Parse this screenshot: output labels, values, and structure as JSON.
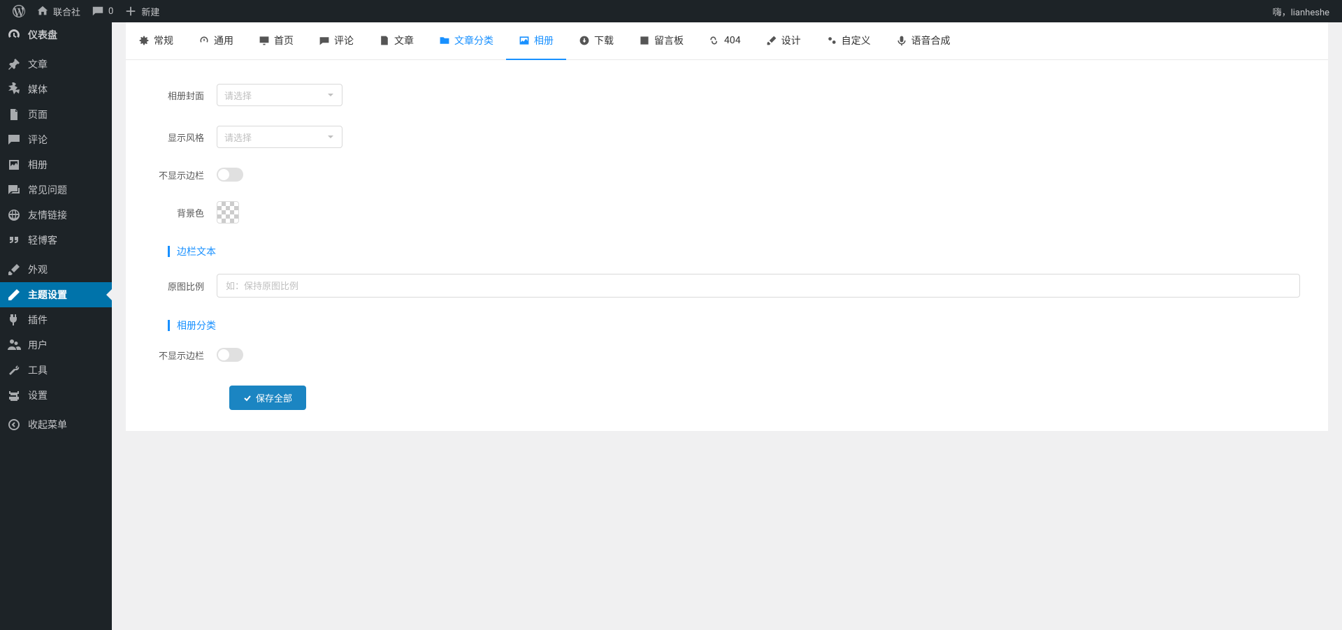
{
  "adminbar": {
    "site_name": "联合社",
    "comments_count": "0",
    "new_label": "新建",
    "greeting": "嗨，lianheshe"
  },
  "sidebar": {
    "dashboard": "仪表盘",
    "posts": "文章",
    "media": "媒体",
    "pages": "页面",
    "comments": "评论",
    "gallery": "相册",
    "faq": "常见问题",
    "links": "友情链接",
    "microblog": "轻博客",
    "appearance": "外观",
    "theme_settings": "主题设置",
    "plugins": "插件",
    "users": "用户",
    "tools": "工具",
    "settings": "设置",
    "collapse": "收起菜单"
  },
  "tabs": {
    "general": "常规",
    "common": "通用",
    "home": "首页",
    "comments": "评论",
    "posts": "文章",
    "categories": "文章分类",
    "gallery": "相册",
    "download": "下载",
    "guestbook": "留言板",
    "p404": "404",
    "design": "设计",
    "customize": "自定义",
    "tts": "语音合成"
  },
  "form": {
    "cover_label": "相册封面",
    "style_label": "显示风格",
    "select_placeholder": "请选择",
    "hide_sidebar_label": "不显示边栏",
    "bg_color_label": "背景色",
    "section_sidebar_text": "边栏文本",
    "ratio_label": "原图比例",
    "ratio_placeholder": "如：保持原图比例",
    "section_gallery_cat": "相册分类",
    "hide_sidebar2_label": "不显示边栏",
    "save_button": "保存全部"
  }
}
